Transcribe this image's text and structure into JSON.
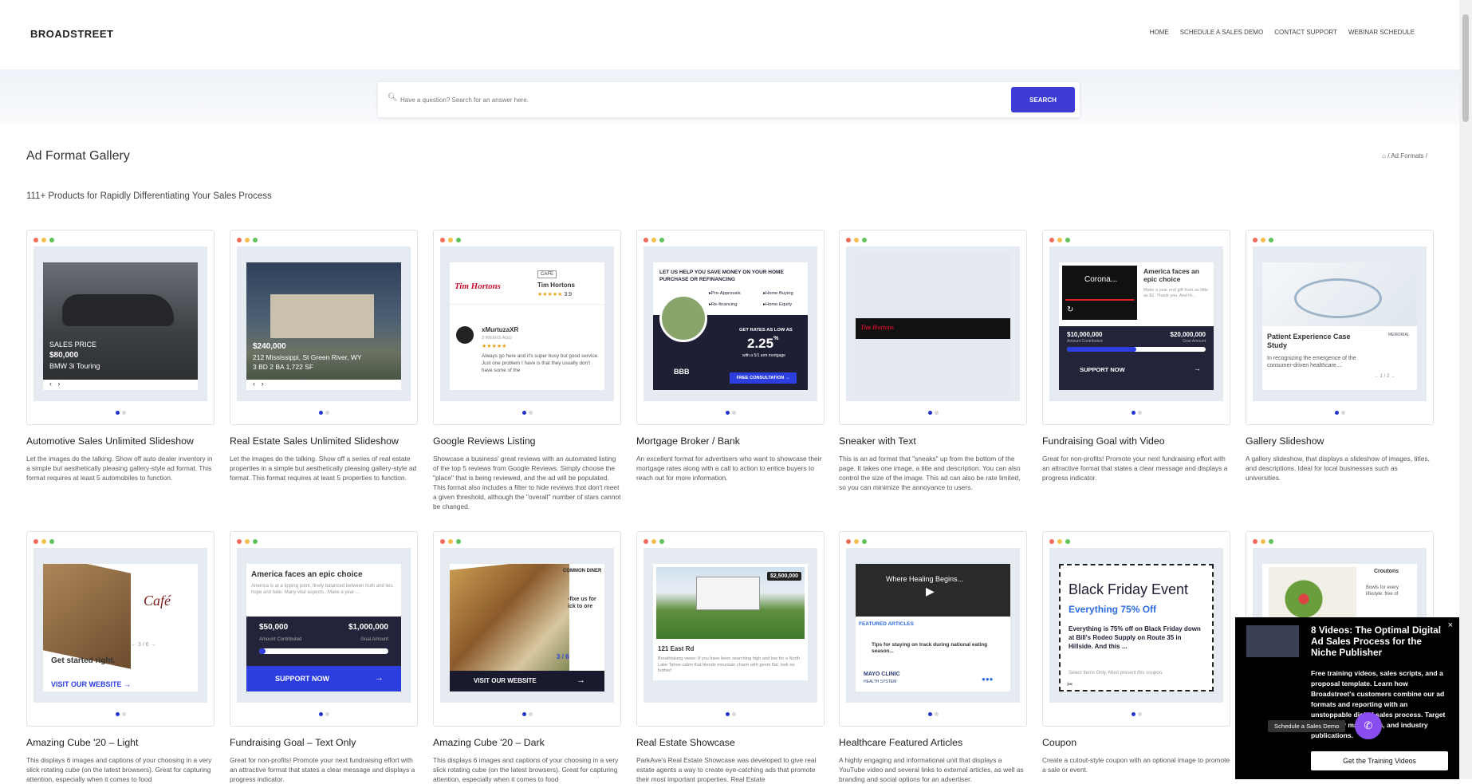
{
  "header": {
    "logo": "BROADSTREET",
    "nav": [
      "HOME",
      "SCHEDULE A SALES DEMO",
      "CONTACT SUPPORT",
      "WEBINAR SCHEDULE"
    ]
  },
  "search": {
    "placeholder": "Have a question? Search for an answer here.",
    "button": "SEARCH"
  },
  "page": {
    "title": "Ad Format Gallery",
    "breadcrumb": "/ Ad Formats /",
    "subtitle": "111+ Products for Rapidly Differentiating Your Sales Process"
  },
  "cards": [
    {
      "title": "Automotive Sales Unlimited Slideshow",
      "desc": "Let the images do the talking. Show off auto dealer inventory in a simple but aesthetically pleasing gallery-style ad format. This format requires at least 5 automobiles to function.",
      "preview": {
        "l1": "SALES PRICE",
        "l2": "$80,000",
        "l3": "BMW 3i Touring"
      }
    },
    {
      "title": "Real Estate Sales Unlimited Slideshow",
      "desc": "Let the images do the talking. Show off a series of real estate properties in a simple but aesthetically pleasing gallery-style ad format. This format requires at least 5 properties to function.",
      "preview": {
        "l1": "$240,000",
        "l2": "212 Mississippi, St Green River, WY",
        "l3": "3 BD  2 BA  1,722 SF"
      }
    },
    {
      "title": "Google Reviews Listing",
      "desc": "Showcase a business' great reviews with an automated listing of the top 5 reviews from Google Reviews. Simply choose the \"place\" that is being reviewed, and the ad will be populated. This format also includes a filter to hide reviews that don't meet a given threshold, although the \"overall\" number of stars cannot be changed.",
      "preview": {
        "brand": "Tim Hortons",
        "tag": "CAFE",
        "name": "Tim Hortons",
        "rating": "3.9",
        "reviewer": "xMurtuzaXR",
        "ago": "3 WEEKS AGO",
        "review": "Always go here and it's super busy but good service. Just one problem I have is that they usually don't have some of the"
      }
    },
    {
      "title": "Mortgage Broker / Bank",
      "desc": "An excellent format for advertisers who want to showcase their mortgage rates along with a call to action to entice buyers to reach out for more information.",
      "preview": {
        "head": "LET US HELP YOU SAVE MONEY ON YOUR HOME PURCHASE OR REFINANCING",
        "o1": "Pre-Approvals",
        "o2": "Home Buying",
        "o3": "Re-financing",
        "o4": "Home Equity",
        "ratelabel": "GET RATES AS LOW AS",
        "rate": "2.25",
        "pct": "%",
        "ratesub": "with a 5/1 arm mortgage",
        "bbb": "BBB",
        "cta": "FREE CONSULTATION →"
      }
    },
    {
      "title": "Sneaker with Text",
      "desc": "This is an ad format that \"sneaks\" up from the bottom of the page. It takes one image, a title and description. You can also control the size of the image. This ad can also be rate limited, so you can minimize the annoyance to users.",
      "preview": {
        "brand": "Tim Hortons"
      }
    },
    {
      "title": "Fundraising Goal with Video",
      "desc": "Great for non-profits! Promote your next fundraising effort with an attractive format that states a clear message and displays a progress indicator.",
      "preview": {
        "video": "Corona...",
        "head": "America faces an epic choice",
        "body": "Make a year end gift from as little as $1. Thank you. And th...",
        "raised": "$10,000,000",
        "raisedlabel": "Amount Contributed",
        "goal": "$20,000,000",
        "goallabel": "Goal Amount",
        "cta": "SUPPORT NOW"
      }
    },
    {
      "title": "Gallery Slideshow",
      "desc": "A gallery slideshow, that displays a slideshow of images, titles, and descriptions. Ideal for local businesses such as universities.",
      "preview": {
        "head": "Patient Experience Case Study",
        "body": "In recognizing the emergence of the consumer-driven healthcare....",
        "page": "1 / 2",
        "brand": "MEMORIAL"
      }
    },
    {
      "title": "Amazing Cube '20 – Light",
      "desc": "This displays 6 images and captions of your choosing in a very slick rotating cube (on the latest browsers). Great for capturing attention, especially when it comes to food",
      "preview": {
        "brand": "Café",
        "caption": "Get started right.",
        "page": "3 / 6",
        "cta": "VISIT OUR WEBSITE →"
      }
    },
    {
      "title": "Fundraising Goal – Text Only",
      "desc": "Great for non-profits! Promote your next fundraising effort with an attractive format that states a clear message and displays a progress indicator.",
      "preview": {
        "head": "America faces an epic choice",
        "body": "America is at a tipping point, finely balanced between truth and lies, hope and hate. Many vital aspects...Make a year-...",
        "raised": "$50,000",
        "raisedlabel": "Amount Contributed",
        "goal": "$1,000,000",
        "goallabel": "Goal Amount",
        "cta": "SUPPORT NOW"
      }
    },
    {
      "title": "Amazing Cube '20 – Dark",
      "desc": "This displays 6 images and captions of your choosing in a very slick rotating cube (on the latest browsers). Great for capturing attention, especially when it comes to food",
      "preview": {
        "brand": "COMMON DINER",
        "side": "-fixe us for ick to ore",
        "page": "3 / 6",
        "cta": "VISIT OUR WEBSITE"
      }
    },
    {
      "title": "Real Estate Showcase",
      "desc": "ParkAve's Real Estate Showcase was developed to give real estate agents a way to create eye-catching ads that promote their most important properties. Real Estate",
      "preview": {
        "price": "$2,500,000",
        "address": "121 East Rd",
        "body": "Breathtaking views: If you have been searching high and low for a North Lake Tahoe cabin that blends mountain charm with geom flat, look no further!"
      }
    },
    {
      "title": "Healthcare Featured Articles",
      "desc": "A highly engaging and informational unit that displays a YouTube video and several links to external articles, as well as branding and social options for an advertiser.",
      "preview": {
        "video": "Where Healing Begins...",
        "label": "FEATURED ARTICLES",
        "article": "Tips for staying on track during national eating season...",
        "brand": "MAYO CLINIC",
        "brandsub": "HEALTH SYSTEM"
      }
    },
    {
      "title": "Coupon",
      "desc": "Create a cutout-style coupon with an optional image to promote a sale or event.",
      "preview": {
        "head": "Black Friday Event",
        "offer": "Everything 75% Off",
        "body": "Everything is 75% off on Black Friday down at Bill's Rodeo Supply on Route 35 in Hillside. And this ...",
        "fine": "Select Items Only. Must present this coupon."
      }
    },
    {
      "title": "",
      "desc": "",
      "preview": {
        "brand": "Croutons",
        "body": "Bowls for every lifestyle: free of"
      }
    }
  ],
  "popup": {
    "title": "8 Videos: The Optimal Digital Ad Sales Process for the Niche Publisher",
    "body": "Free training videos, sales scripts, and a proposal template. Learn how Broadstreet's customers combine our ad formats and reporting with an unstoppable digital sales process. Target locals, city magazines, and industry publications.",
    "cta": "Get the Training Videos",
    "close": "×"
  },
  "chat": {
    "tooltip": "Schedule a Sales Demo"
  }
}
